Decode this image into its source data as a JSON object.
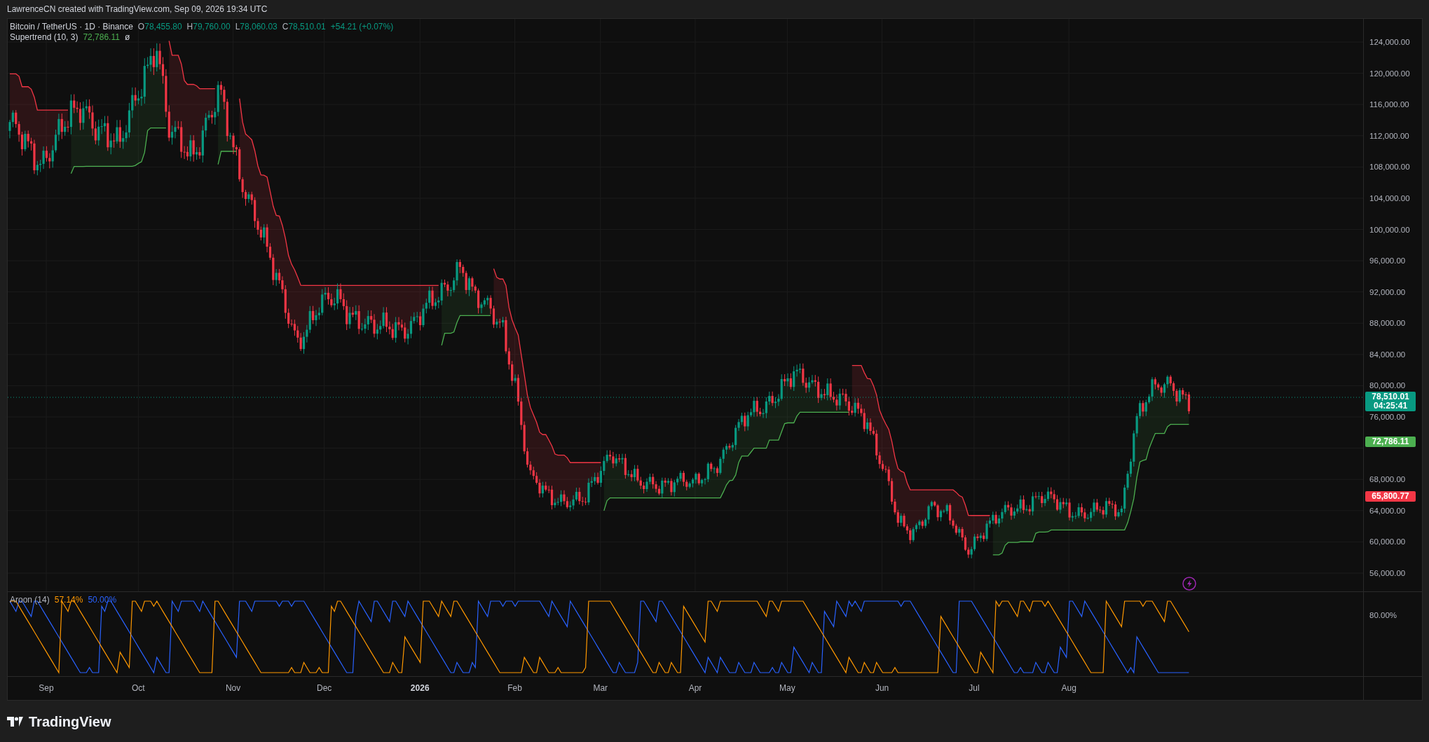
{
  "header": {
    "attribution": "LawrenceCN created with TradingView.com, Sep 09, 2026 19:34 UTC"
  },
  "legend": {
    "symbol": "Bitcoin / TetherUS · 1D · Binance",
    "ohlc": [
      {
        "label": "O",
        "value": "78,455.80"
      },
      {
        "label": "H",
        "value": "79,760.00"
      },
      {
        "label": "L",
        "value": "78,060.03"
      },
      {
        "label": "C",
        "value": "78,510.01"
      }
    ],
    "change": "+54.21 (+0.07%)"
  },
  "supertrend_legend": {
    "name": "Supertrend (10, 3)",
    "value": "72,786.11",
    "symbol": "ø"
  },
  "price_axis": {
    "ticks": [
      "124,000.00",
      "120,000.00",
      "116,000.00",
      "112,000.00",
      "108,000.00",
      "104,000.00",
      "100,000.00",
      "96,000.00",
      "92,000.00",
      "88,000.00",
      "84,000.00",
      "80,000.00",
      "76,000.00",
      "68,000.00",
      "64,000.00",
      "60,000.00",
      "56,000.00"
    ]
  },
  "price_tags": [
    {
      "kind": "last",
      "value": "78,510.01",
      "countdown": "04:25:41",
      "color": "#089981"
    },
    {
      "kind": "supertrend",
      "value": "72,786.11",
      "color": "#4caf50"
    },
    {
      "kind": "level",
      "value": "65,800.77",
      "color": "#f23645"
    }
  ],
  "aroon": {
    "name": "Aroon (14)",
    "up": "57.14%",
    "down": "50.00%",
    "axis_label": "80.00%"
  },
  "time_axis": [
    {
      "label": "Sep",
      "bold": false
    },
    {
      "label": "Oct",
      "bold": false
    },
    {
      "label": "Nov",
      "bold": false
    },
    {
      "label": "Dec",
      "bold": false
    },
    {
      "label": "2026",
      "bold": true
    },
    {
      "label": "Feb",
      "bold": false
    },
    {
      "label": "Mar",
      "bold": false
    },
    {
      "label": "Apr",
      "bold": false
    },
    {
      "label": "May",
      "bold": false
    },
    {
      "label": "Jun",
      "bold": false
    },
    {
      "label": "Jul",
      "bold": false
    },
    {
      "label": "Aug",
      "bold": false
    }
  ],
  "footer": {
    "logo": "TradingView"
  }
}
